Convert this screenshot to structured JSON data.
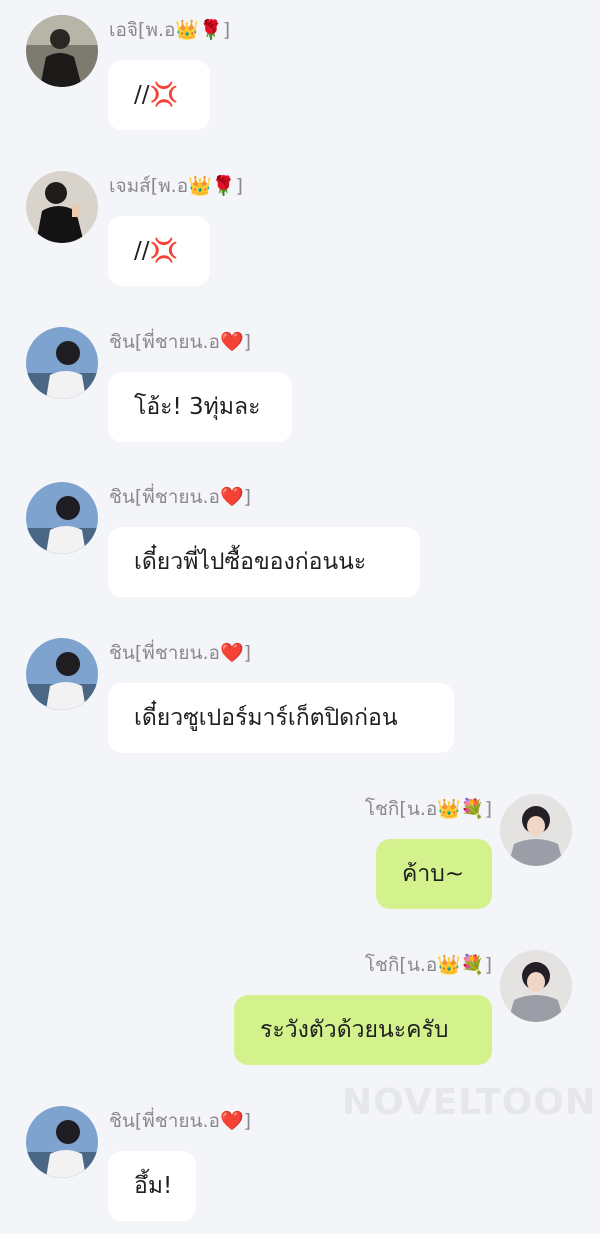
{
  "chat": {
    "messages": [
      {
        "side": "left",
        "avatar": "avatar-eji",
        "name": "เอจิ[พ.อ👑🌹]",
        "text": "//💢",
        "bubble_width": 102
      },
      {
        "side": "left",
        "avatar": "avatar-james",
        "name": "เจมส์[พ.อ👑🌹]",
        "text": "//💢",
        "bubble_width": 102
      },
      {
        "side": "left",
        "avatar": "avatar-shin",
        "name": "ชิน[พี่ชายน.อ❤️]",
        "text": "โอ้ะ! 3ทุ่มละ",
        "bubble_width": 184
      },
      {
        "side": "left",
        "avatar": "avatar-shin",
        "name": "ชิน[พี่ชายน.อ❤️]",
        "text": "เดี๋ยวพี่ไปซื้อของก่อนนะ",
        "bubble_width": 312
      },
      {
        "side": "left",
        "avatar": "avatar-shin",
        "name": "ชิน[พี่ชายน.อ❤️]",
        "text": "เดี๋ยวซูเปอร์มาร์เก็ตปิดก่อน",
        "bubble_width": 346
      },
      {
        "side": "right",
        "avatar": "avatar-shogi",
        "name": "โชกิ[น.อ👑💐]",
        "text": "ค้าบ~",
        "bubble_width": 116
      },
      {
        "side": "right",
        "avatar": "avatar-shogi",
        "name": "โชกิ[น.อ👑💐]",
        "text": "ระวังตัวด้วยนะครับ",
        "bubble_width": 258
      },
      {
        "side": "left",
        "avatar": "avatar-shin",
        "name": "ชิน[พี่ชายน.อ❤️]",
        "text": "อึ้ม!",
        "bubble_width": 88
      }
    ]
  },
  "watermark": {
    "text": "NOVELTOON"
  },
  "colors": {
    "background": "#f4f5f8",
    "bubble_left": "#ffffff",
    "bubble_right": "#d3f28d",
    "name_text": "#8a8a8e"
  }
}
